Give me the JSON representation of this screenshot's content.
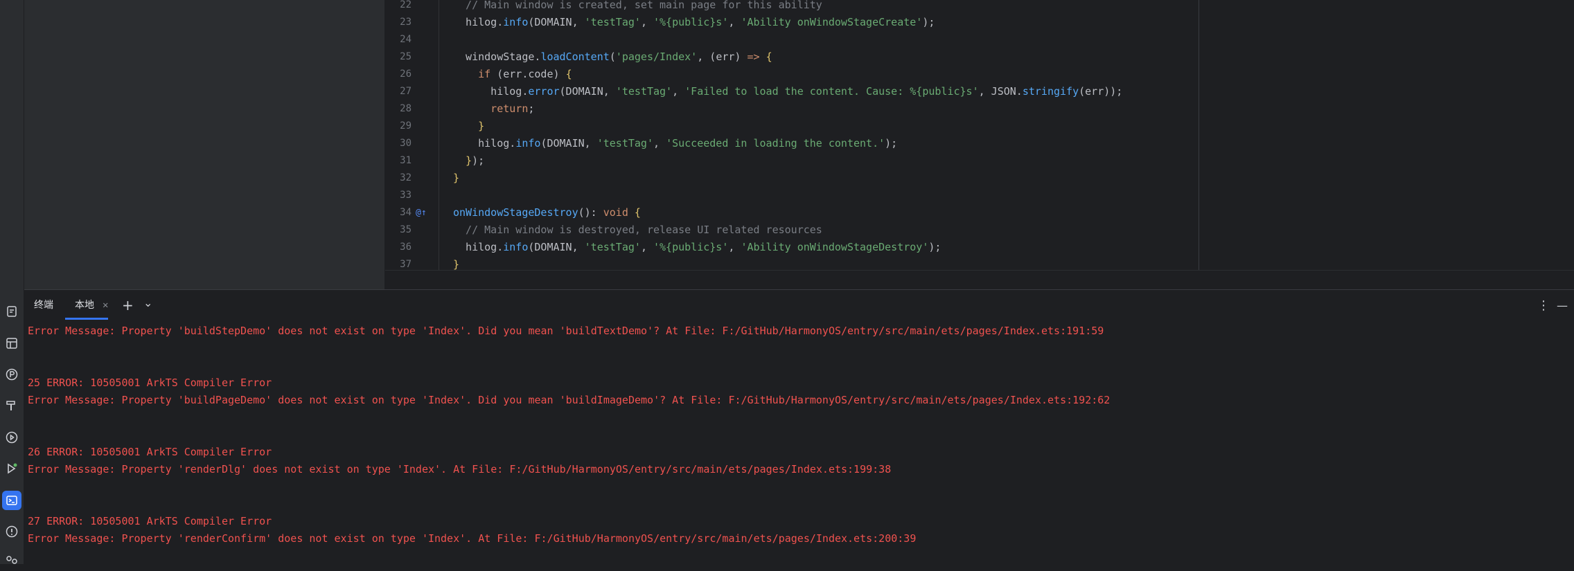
{
  "activity_bar": {
    "icons": [
      "bookmarks-icon",
      "structure-icon",
      "plugin-p-icon",
      "build-hammer-icon",
      "services-icon",
      "run-icon",
      "terminal-icon",
      "problems-icon",
      "settings-icon"
    ],
    "active": "terminal-icon",
    "accent": "#3574f0"
  },
  "editor": {
    "lines": [
      {
        "n": "22",
        "parts": [
          [
            "c-comment",
            "  // Main window is created, set main page for this ability"
          ]
        ]
      },
      {
        "n": "23",
        "parts": [
          [
            "c-id",
            "  hilog."
          ],
          [
            "c-method",
            "info"
          ],
          [
            "c-id",
            "(DOMAIN, "
          ],
          [
            "c-str2",
            "'testTag'"
          ],
          [
            "c-id",
            ", "
          ],
          [
            "c-str2",
            "'%{public}s'"
          ],
          [
            "c-id",
            ", "
          ],
          [
            "c-str2",
            "'Ability onWindowStageCreate'"
          ],
          [
            "c-id",
            ");"
          ]
        ]
      },
      {
        "n": "24",
        "parts": []
      },
      {
        "n": "25",
        "parts": [
          [
            "c-id",
            "  windowStage."
          ],
          [
            "c-method",
            "loadContent"
          ],
          [
            "c-id",
            "("
          ],
          [
            "c-str2",
            "'pages/Index'"
          ],
          [
            "c-id",
            ", ("
          ],
          [
            "c-id",
            "err"
          ],
          [
            "c-id",
            ") "
          ],
          [
            "c-kw",
            "=>"
          ],
          [
            "c-id",
            " "
          ],
          [
            "c-br",
            "{"
          ]
        ]
      },
      {
        "n": "26",
        "parts": [
          [
            "c-kw",
            "    if"
          ],
          [
            "c-id",
            " (err."
          ],
          [
            "c-id",
            "code"
          ],
          [
            "c-id",
            ") "
          ],
          [
            "c-br",
            "{"
          ]
        ]
      },
      {
        "n": "27",
        "parts": [
          [
            "c-id",
            "      hilog."
          ],
          [
            "c-method",
            "error"
          ],
          [
            "c-id",
            "(DOMAIN, "
          ],
          [
            "c-str2",
            "'testTag'"
          ],
          [
            "c-id",
            ", "
          ],
          [
            "c-str2",
            "'Failed to load the content. Cause: %{public}s'"
          ],
          [
            "c-id",
            ", JSON."
          ],
          [
            "c-method",
            "stringify"
          ],
          [
            "c-id",
            "(err));"
          ]
        ]
      },
      {
        "n": "28",
        "parts": [
          [
            "c-kw",
            "      return"
          ],
          [
            "c-id",
            ";"
          ]
        ]
      },
      {
        "n": "29",
        "parts": [
          [
            "c-br",
            "    }"
          ]
        ]
      },
      {
        "n": "30",
        "parts": [
          [
            "c-id",
            "    hilog."
          ],
          [
            "c-method",
            "info"
          ],
          [
            "c-id",
            "(DOMAIN, "
          ],
          [
            "c-str2",
            "'testTag'"
          ],
          [
            "c-id",
            ", "
          ],
          [
            "c-str2",
            "'Succeeded in loading the content.'"
          ],
          [
            "c-id",
            ");"
          ]
        ]
      },
      {
        "n": "31",
        "parts": [
          [
            "c-br",
            "  }"
          ],
          [
            "c-id",
            ");"
          ]
        ]
      },
      {
        "n": "32",
        "parts": [
          [
            "c-br",
            "}"
          ]
        ]
      },
      {
        "n": "33",
        "parts": []
      },
      {
        "n": "34",
        "parts": [
          [
            "c-method",
            "onWindowStageDestroy"
          ],
          [
            "c-id",
            "(): "
          ],
          [
            "c-kw",
            "void"
          ],
          [
            "c-id",
            " "
          ],
          [
            "c-br",
            "{"
          ]
        ],
        "mark": "@↑"
      },
      {
        "n": "35",
        "parts": [
          [
            "c-comment",
            "  // Main window is destroyed, release UI related resources"
          ]
        ]
      },
      {
        "n": "36",
        "parts": [
          [
            "c-id",
            "  hilog."
          ],
          [
            "c-method",
            "info"
          ],
          [
            "c-id",
            "(DOMAIN, "
          ],
          [
            "c-str2",
            "'testTag'"
          ],
          [
            "c-id",
            ", "
          ],
          [
            "c-str2",
            "'%{public}s'"
          ],
          [
            "c-id",
            ", "
          ],
          [
            "c-str2",
            "'Ability onWindowStageDestroy'"
          ],
          [
            "c-id",
            ");"
          ]
        ]
      },
      {
        "n": "37",
        "parts": [
          [
            "c-br",
            "}"
          ]
        ]
      }
    ]
  },
  "terminal": {
    "tabs": [
      {
        "label": "终端"
      },
      {
        "label": "本地",
        "active": true
      }
    ],
    "new_tab_symbol": "+",
    "dropdown_symbol": "⌄",
    "more_symbol": "⋮",
    "minimize_symbol": "—",
    "output": [
      "Error Message: Property 'buildStepDemo' does not exist on type 'Index'. Did you mean 'buildTextDemo'? At File: F:/GitHub/HarmonyOS/entry/src/main/ets/pages/Index.ets:191:59",
      "",
      "",
      "25 ERROR: 10505001 ArkTS Compiler Error",
      "Error Message: Property 'buildPageDemo' does not exist on type 'Index'. Did you mean 'buildImageDemo'? At File: F:/GitHub/HarmonyOS/entry/src/main/ets/pages/Index.ets:192:62",
      "",
      "",
      "26 ERROR: 10505001 ArkTS Compiler Error",
      "Error Message: Property 'renderDlg' does not exist on type 'Index'. At File: F:/GitHub/HarmonyOS/entry/src/main/ets/pages/Index.ets:199:38",
      "",
      "",
      "27 ERROR: 10505001 ArkTS Compiler Error",
      "Error Message: Property 'renderConfirm' does not exist on type 'Index'. At File: F:/GitHub/HarmonyOS/entry/src/main/ets/pages/Index.ets:200:39"
    ],
    "error_color": "#f0524f"
  }
}
